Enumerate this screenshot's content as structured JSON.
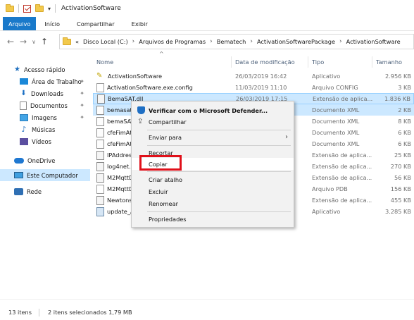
{
  "window": {
    "title": "ActivationSoftware"
  },
  "ribbon": {
    "tabs": [
      "Arquivo",
      "Início",
      "Compartilhar",
      "Exibir"
    ]
  },
  "address": {
    "prefix": "«",
    "crumbs": [
      "Disco Local (C:)",
      "Arquivos de Programas",
      "Bematech",
      "ActivationSoftwarePackage",
      "ActivationSoftware"
    ]
  },
  "columns": {
    "name": "Nome",
    "date": "Data de modificação",
    "type": "Tipo",
    "size": "Tamanho"
  },
  "sidebar": {
    "items": [
      {
        "label": "Acesso rápido",
        "icon": "star-icon"
      },
      {
        "label": "Área de Trabalho",
        "icon": "desktop-icon",
        "pinned": true
      },
      {
        "label": "Downloads",
        "icon": "download-icon",
        "pinned": true
      },
      {
        "label": "Documentos",
        "icon": "documents-icon",
        "pinned": true
      },
      {
        "label": "Imagens",
        "icon": "pictures-icon",
        "pinned": true
      },
      {
        "label": "Músicas",
        "icon": "music-icon"
      },
      {
        "label": "Vídeos",
        "icon": "videos-icon"
      },
      {
        "label": "OneDrive",
        "icon": "onedrive-icon"
      },
      {
        "label": "Este Computador",
        "icon": "pc-icon",
        "selected": true
      },
      {
        "label": "Rede",
        "icon": "network-icon"
      }
    ]
  },
  "files": [
    {
      "name": "ActivationSoftware",
      "date": "26/03/2019 16:42",
      "type": "Aplicativo",
      "size": "2.956 KB",
      "kind": "exe"
    },
    {
      "name": "ActivationSoftware.exe.config",
      "date": "11/03/2019 11:10",
      "type": "Arquivo CONFIG",
      "size": "3 KB",
      "kind": "config"
    },
    {
      "name": "BemaSAT.dll",
      "date": "26/03/2019 17:15",
      "type": "Extensão de aplica...",
      "size": "1.836 KB",
      "kind": "dll",
      "selected": true
    },
    {
      "name": "bemasat.xml",
      "date": "",
      "type": "Documento XML",
      "size": "2 KB",
      "kind": "xml",
      "selected": true
    },
    {
      "name": "bemaSAT.xml",
      "date": "",
      "type": "Documento XML",
      "size": "8 KB",
      "kind": "xml"
    },
    {
      "name": "cfeFimAtivar.xml",
      "date": "",
      "type": "Documento XML",
      "size": "6 KB",
      "kind": "xml"
    },
    {
      "name": "cfeFimAtivar2.xml",
      "date": "",
      "type": "Documento XML",
      "size": "6 KB",
      "kind": "xml"
    },
    {
      "name": "IPAddressControlLib.dll",
      "date": "",
      "type": "Extensão de aplica...",
      "size": "25 KB",
      "kind": "dll"
    },
    {
      "name": "log4net.dll",
      "date": "",
      "type": "Extensão de aplica...",
      "size": "270 KB",
      "kind": "dll"
    },
    {
      "name": "M2MqttDotnetCore.dll",
      "date": "",
      "type": "Extensão de aplica...",
      "size": "56 KB",
      "kind": "dll"
    },
    {
      "name": "M2MqttDotnetCore.pdb",
      "date": "",
      "type": "Arquivo PDB",
      "size": "156 KB",
      "kind": "pdb"
    },
    {
      "name": "Newtonsoft.Json.dll",
      "date": "",
      "type": "Extensão de aplica...",
      "size": "455 KB",
      "kind": "dll"
    },
    {
      "name": "update_ActivationSoftware",
      "date": "",
      "type": "Aplicativo",
      "size": "3.285 KB",
      "kind": "app2"
    }
  ],
  "context_menu": {
    "items": [
      {
        "label": "Verificar com o Microsoft Defender...",
        "icon": "shield-icon"
      },
      {
        "label": "Compartilhar",
        "icon": "share-icon"
      },
      {
        "label": "Enviar para",
        "submenu": true
      },
      {
        "label": "Recortar"
      },
      {
        "label": "Copiar",
        "highlighted": true
      },
      {
        "label": "Criar atalho"
      },
      {
        "label": "Excluir"
      },
      {
        "label": "Renomear"
      },
      {
        "label": "Propriedades"
      }
    ]
  },
  "status": {
    "count": "13 itens",
    "selection": "2 itens selecionados  1,79 MB"
  }
}
